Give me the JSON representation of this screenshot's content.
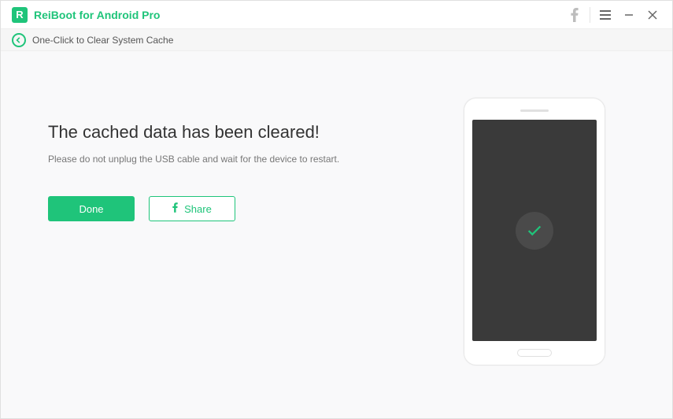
{
  "titlebar": {
    "title": "ReiBoot for Android Pro"
  },
  "subheader": {
    "label": "One-Click to Clear System Cache"
  },
  "main": {
    "title": "The cached data has been cleared!",
    "subtitle": "Please do not unplug the USB cable and wait for the device to restart.",
    "done_label": "Done",
    "share_label": "Share"
  },
  "colors": {
    "accent": "#1fc47a"
  }
}
